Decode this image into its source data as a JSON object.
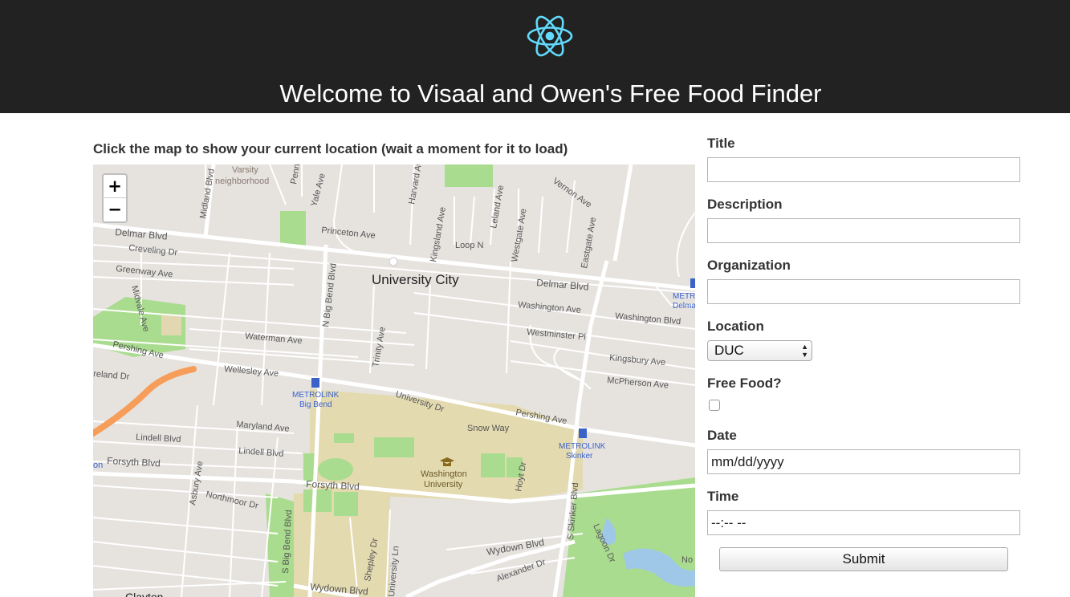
{
  "header": {
    "title": "Welcome to Visaal and Owen's Free Food Finder",
    "logo": "react-atom-logo"
  },
  "map": {
    "instructions": "Click the map to show your current location (wait a moment for it to load)",
    "zoom_in": "+",
    "zoom_out": "−",
    "labels": {
      "varsity": "Varsity",
      "neighborhood": "neighborhood",
      "midland": "Midland Blvd",
      "yale": "Yale Ave",
      "penn": "Penn",
      "harvard": "Harvard Ave",
      "kingsland": "Kingsland Ave",
      "leland": "Leland Ave",
      "westgate": "Westgate Ave",
      "eastgate": "Eastgate Ave",
      "vernon": "Vernon Ave",
      "delmar_w": "Delmar Blvd",
      "delmar_e": "Delmar Blvd",
      "creveling": "Creveling Dr",
      "greenway": "Greenway Ave",
      "princeton": "Princeton Ave",
      "loop_n": "Loop N",
      "university_city": "University City",
      "midvale": "Midvale Ave",
      "n_big_bend": "N Big Bend Blvd",
      "washington_ave": "Washington Ave",
      "washington_blvd": "Washington Blvd",
      "metro_delmar": "METR",
      "metro_delmar2": "Delma",
      "waterman": "Waterman Ave",
      "trinity": "Trinity Ave",
      "westminster": "Westminster Pl",
      "pershing_w": "Pershing Ave",
      "wellesley": "Wellesley Ave",
      "kingsbury": "Kingsbury Ave",
      "mcpherson": "McPherson Ave",
      "ireland": "reland Dr",
      "metrolink_bb": "METROLINK",
      "big_bend": "Big Bend",
      "university_dr": "University Dr",
      "pershing_e": "Pershing Ave",
      "snow_way": "Snow Way",
      "metrolink_sk": "METROLINK",
      "skinker": "Skinker",
      "maryland": "Maryland Ave",
      "lindell_w": "Lindell Blvd",
      "lindell_c": "Lindell Blvd",
      "washington_univ": "Washington",
      "university": "University",
      "forsyth_w": "Forsyth Blvd",
      "forsyth_c": "Forsyth Blvd",
      "hoyt": "Hoyt Dr",
      "asbury": "Asbury Ave",
      "northmoor": "Northmoor Dr",
      "s_big_bend": "S Big Bend Blvd",
      "s_skinker": "S Skinker Blvd",
      "lagoon": "Lagoon Dr",
      "wydown_e": "Wydown Blvd",
      "wydown_s": "Wydown Blvd",
      "shepley": "Shepley Dr",
      "university_ln": "University Ln",
      "alexander": "Alexander Dr",
      "clayton": "Clayton",
      "no": "No",
      "on": "on"
    }
  },
  "form": {
    "title_label": "Title",
    "title_value": "",
    "description_label": "Description",
    "description_value": "",
    "organization_label": "Organization",
    "organization_value": "",
    "location_label": "Location",
    "location_value": "DUC",
    "free_food_label": "Free Food?",
    "free_food_checked": false,
    "date_label": "Date",
    "date_value": "mm/dd/yyyy",
    "time_label": "Time",
    "time_value": "--:-- --",
    "submit_label": "Submit"
  }
}
